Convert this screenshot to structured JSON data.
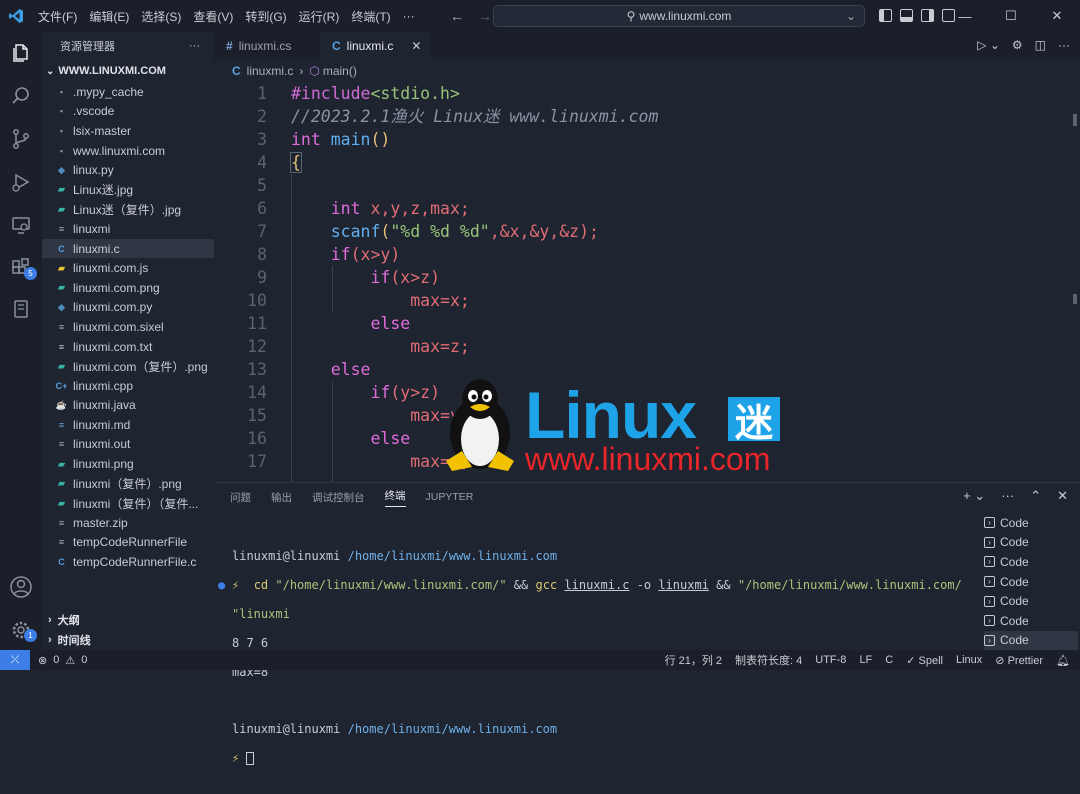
{
  "menu": [
    "文件(F)",
    "编辑(E)",
    "选择(S)",
    "查看(V)",
    "转到(G)",
    "运行(R)",
    "终端(T)",
    "···"
  ],
  "command_center": "www.linuxmi.com",
  "sidebar": {
    "title": "资源管理器",
    "more": "···",
    "folder": "WWW.LINUXMI.COM",
    "files": [
      {
        "name": ".mypy_cache",
        "icon": "folder-icon"
      },
      {
        "name": ".vscode",
        "icon": "folder-icon"
      },
      {
        "name": "lsix-master",
        "icon": "folder-icon"
      },
      {
        "name": "www.linuxmi.com",
        "icon": "folder-icon"
      },
      {
        "name": "linux.py",
        "icon": "python-icon"
      },
      {
        "name": "Linux迷.jpg",
        "icon": "image-icon"
      },
      {
        "name": "Linux迷（复件）.jpg",
        "icon": "image-icon"
      },
      {
        "name": "linuxmi",
        "icon": "file-icon"
      },
      {
        "name": "linuxmi.c",
        "icon": "c-icon"
      },
      {
        "name": "linuxmi.com.js",
        "icon": "js-icon"
      },
      {
        "name": "linuxmi.com.png",
        "icon": "image-icon"
      },
      {
        "name": "linuxmi.com.py",
        "icon": "python-icon"
      },
      {
        "name": "linuxmi.com.sixel",
        "icon": "file-icon"
      },
      {
        "name": "linuxmi.com.txt",
        "icon": "text-icon"
      },
      {
        "name": "linuxmi.com（复件）.png",
        "icon": "image-icon"
      },
      {
        "name": "linuxmi.cpp",
        "icon": "cpp-icon"
      },
      {
        "name": "linuxmi.java",
        "icon": "java-icon"
      },
      {
        "name": "linuxmi.md",
        "icon": "markdown-icon"
      },
      {
        "name": "linuxmi.out",
        "icon": "file-icon"
      },
      {
        "name": "linuxmi.png",
        "icon": "image-icon"
      },
      {
        "name": "linuxmi（复件）.png",
        "icon": "image-icon"
      },
      {
        "name": "linuxmi（复件）（复件...",
        "icon": "image-icon"
      },
      {
        "name": "master.zip",
        "icon": "zip-icon"
      },
      {
        "name": "tempCodeRunnerFile",
        "icon": "file-icon"
      },
      {
        "name": "tempCodeRunnerFile.c",
        "icon": "c-icon"
      }
    ],
    "outline": "大纲",
    "timeline": "时间线"
  },
  "activity_badges": {
    "extensions": "5",
    "settings": "1"
  },
  "tabs": [
    {
      "label": "linuxmi.cs",
      "icon": "#"
    },
    {
      "label": "linuxmi.c",
      "icon": "C",
      "close": "✕"
    }
  ],
  "breadcrumb": {
    "file": "linuxmi.c",
    "sep": "›",
    "symbol": "main()"
  },
  "line_numbers": [
    "1",
    "2",
    "3",
    "4",
    "5",
    "6",
    "7",
    "8",
    "9",
    "10",
    "11",
    "12",
    "13",
    "14",
    "15",
    "16",
    "17"
  ],
  "code": {
    "l1a": "#include",
    "l1b": "<stdio.h>",
    "l2": "//2023.2.1渔火 Linux迷 www.linuxmi.com",
    "l3a": "int",
    "l3b": "main",
    "l3c": "()",
    "l4": "{",
    "l6a": "int",
    "l6b": "x,y,z,max;",
    "l7a": "scanf",
    "l7b": "(",
    "l7c": "\"%d %d %d\"",
    "l7d": ",&x,&y,&z);",
    "l8a": "if",
    "l8b": "(x>y)",
    "l9a": "if",
    "l9b": "(x>z)",
    "l10": "max=x;",
    "l11": "else",
    "l12": "max=z;",
    "l13": "else",
    "l14a": "if",
    "l14b": "(y>z)",
    "l15": "max=y;",
    "l16": "else",
    "l17": "max=z;"
  },
  "logo": {
    "word": "Linux",
    "cn": "迷",
    "url": "www.linuxmi.com"
  },
  "panel": {
    "tabs": [
      "问题",
      "输出",
      "调试控制台",
      "终端",
      "JUPYTER"
    ],
    "active_tab": "终端",
    "terminal": {
      "prompt_user": "linuxmi@linuxmi",
      "prompt_path": "/home/linuxmi/www.linuxmi.com",
      "bolt": "⚡",
      "cd": "cd",
      "cd_arg": "\"/home/linuxmi/www.linuxmi.com/\"",
      "and1": "&&",
      "gcc": "gcc",
      "gcc_src": "linuxmi.c",
      "gcc_o": "-o",
      "gcc_out": "linuxmi",
      "and2": "&&",
      "run1": "\"/home/linuxmi/www.linuxmi.com/",
      "run2": "\"linuxmi",
      "output1": "8 7 6",
      "output2": "max=8"
    },
    "terminals": [
      "Code",
      "Code",
      "Code",
      "Code",
      "Code",
      "Code",
      "Code"
    ]
  },
  "status": {
    "errors": "0",
    "warnings": "0",
    "position": "行 21，列 2",
    "indent": "制表符长度: 4",
    "encoding": "UTF-8",
    "eol": "LF",
    "language": "C",
    "spell": "Spell",
    "os": "Linux",
    "prettier": "Prettier"
  }
}
